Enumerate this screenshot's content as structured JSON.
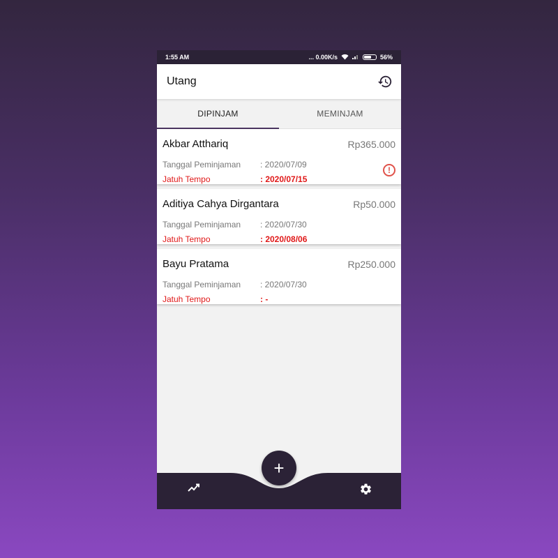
{
  "status_bar": {
    "time": "1:55 AM",
    "speed": "... 0.00K/s",
    "battery": "56%"
  },
  "app_bar": {
    "title": "Utang",
    "history_icon": "history-icon"
  },
  "tabs": [
    {
      "label": "DIPINJAM",
      "active": true
    },
    {
      "label": "MEMINJAM",
      "active": false
    }
  ],
  "debts": [
    {
      "name": "Akbar Atthariq",
      "amount": "Rp365.000",
      "loan_date_label": "Tanggal Peminjaman",
      "loan_date": ": 2020/07/09",
      "due_label": "Jatuh Tempo",
      "due_date": ": 2020/07/15",
      "overdue_icon": "alert-icon"
    },
    {
      "name": "Aditiya Cahya Dirgantara",
      "amount": "Rp50.000",
      "loan_date_label": "Tanggal Peminjaman",
      "loan_date": ": 2020/07/30",
      "due_label": "Jatuh Tempo",
      "due_date": ": 2020/08/06"
    },
    {
      "name": "Bayu Pratama",
      "amount": "Rp250.000",
      "loan_date_label": "Tanggal Peminjaman",
      "loan_date": ": 2020/07/30",
      "due_label": "Jatuh Tempo",
      "due_date": ": -"
    }
  ],
  "bottom_nav": {
    "fab_label": "+",
    "left_icon": "trending-up-icon",
    "right_icon": "settings-icon"
  },
  "colors": {
    "primary_dark": "#2b2236",
    "due_red": "#e01818",
    "alert": "#e0524a"
  }
}
